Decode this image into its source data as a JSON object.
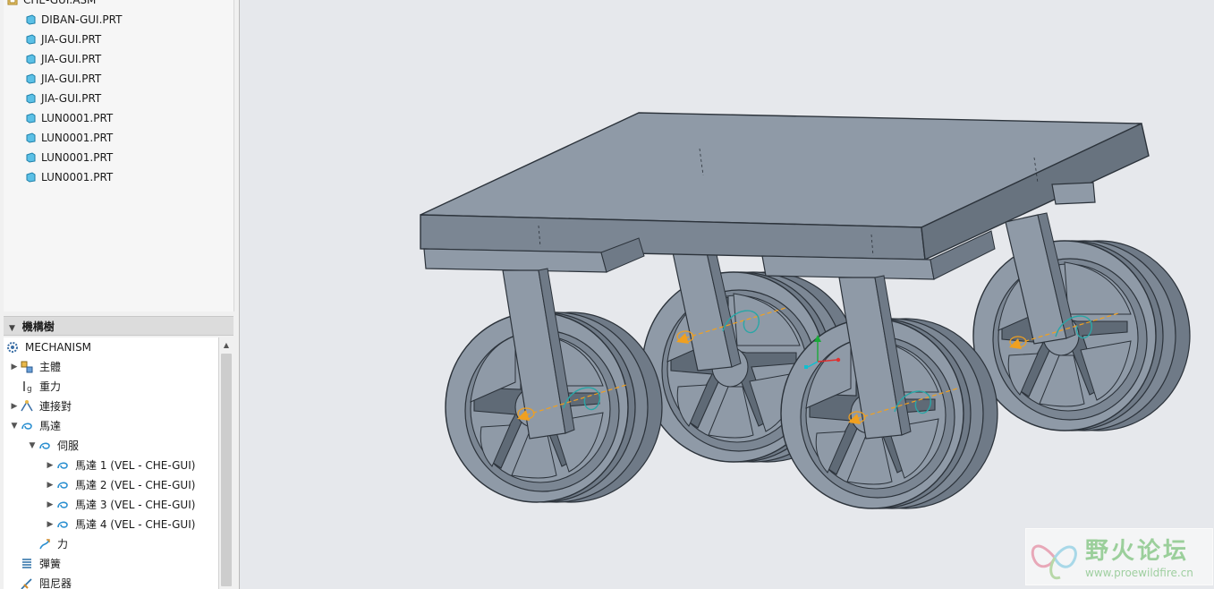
{
  "model_tree": {
    "root": "CHE-GUI.ASM",
    "items": [
      {
        "label": "DIBAN-GUI.PRT"
      },
      {
        "label": "JIA-GUI.PRT"
      },
      {
        "label": "JIA-GUI.PRT"
      },
      {
        "label": "JIA-GUI.PRT"
      },
      {
        "label": "JIA-GUI.PRT"
      },
      {
        "label": "LUN0001.PRT"
      },
      {
        "label": "LUN0001.PRT"
      },
      {
        "label": "LUN0001.PRT"
      },
      {
        "label": "LUN0001.PRT"
      }
    ]
  },
  "mechanism_tree": {
    "header": "機構樹",
    "root": "MECHANISM",
    "items": [
      {
        "label": "主體"
      },
      {
        "label": "重力"
      },
      {
        "label": "連接對"
      },
      {
        "label": "馬達"
      },
      {
        "label": "伺服"
      },
      {
        "label": "馬達 1 (VEL - CHE-GUI)"
      },
      {
        "label": "馬達 2 (VEL - CHE-GUI)"
      },
      {
        "label": "馬達 3 (VEL - CHE-GUI)"
      },
      {
        "label": "馬達 4 (VEL - CHE-GUI)"
      },
      {
        "label": "力"
      },
      {
        "label": "彈簧"
      },
      {
        "label": "阻尼器"
      }
    ]
  },
  "watermark": {
    "title": "野火论坛",
    "url": "www.proewildfire.cn"
  },
  "colors": {
    "model_face": "#8f9aa7",
    "model_side": "#6f7a87",
    "model_edge": "#2c333b",
    "viewport_bg": "#e6e8ec",
    "motor_arrow": "#f0a020",
    "motor_helix": "#2aa6a6"
  }
}
